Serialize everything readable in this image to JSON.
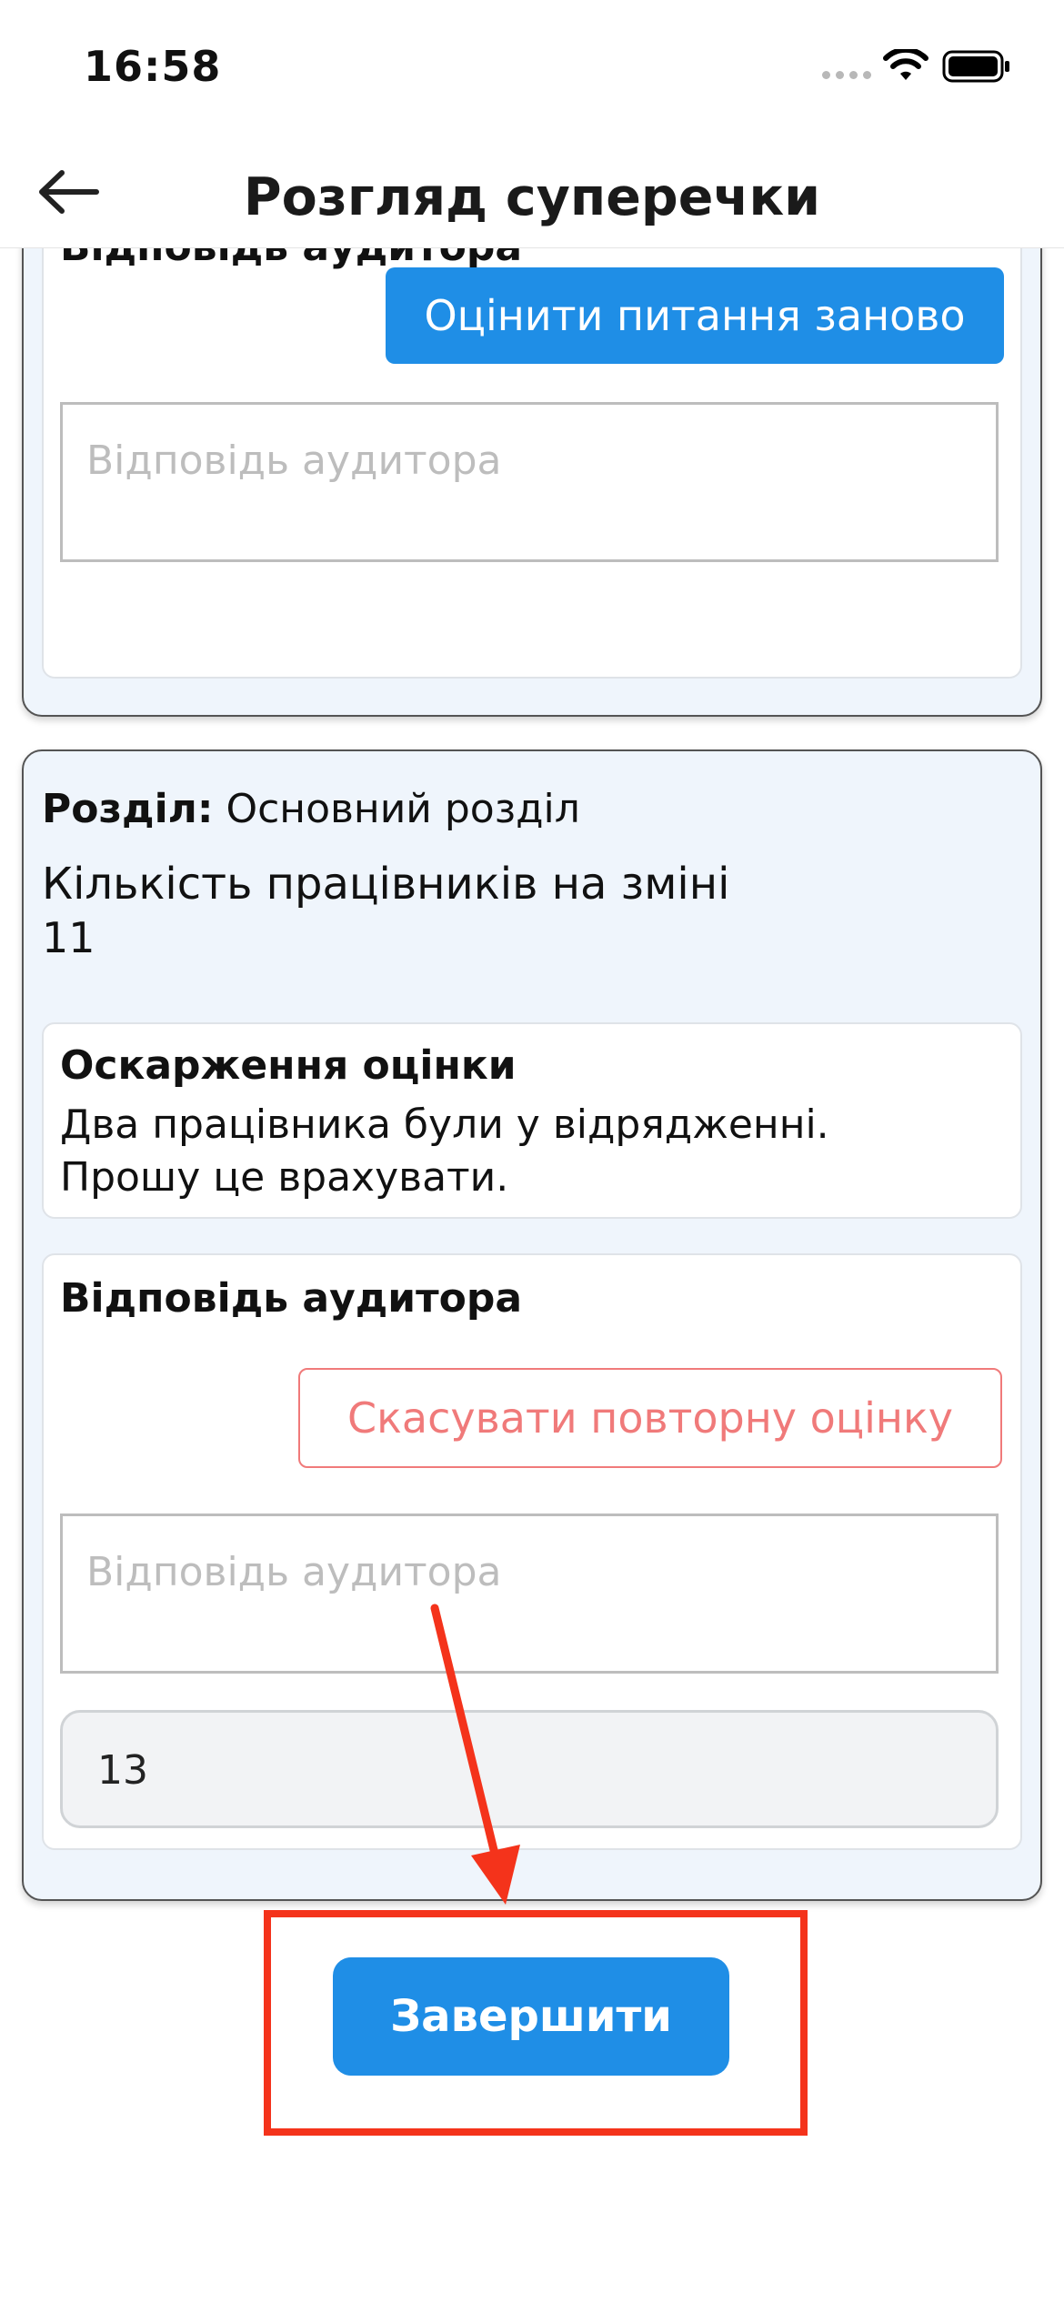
{
  "status_bar": {
    "time": "16:58"
  },
  "header": {
    "title": "Розгляд суперечки"
  },
  "card_top": {
    "auditor_section_title": "Відповідь аудитора",
    "reevaluate_button": "Оцінити питання заново",
    "auditor_placeholder": "Відповідь аудитора"
  },
  "card_main": {
    "section_label": "Розділ:",
    "section_value": "Основний розділ",
    "question": "Кількість працівників на зміні",
    "answer": "11",
    "appeal": {
      "title": "Оскарження оцінки",
      "line1": "Два працівника були у відрядженні.",
      "line2": "Прошу це врахувати."
    },
    "auditor": {
      "title": "Відповідь аудитора",
      "cancel_button": "Скасувати повторну оцінку",
      "placeholder": "Відповідь аудитора",
      "new_value": "13"
    }
  },
  "footer": {
    "finish_button": "Завершити"
  },
  "colors": {
    "primary": "#1f8ee6",
    "cancel": "#f07a7a",
    "annotation": "#f4331b",
    "card_bg": "#eff5fc"
  }
}
